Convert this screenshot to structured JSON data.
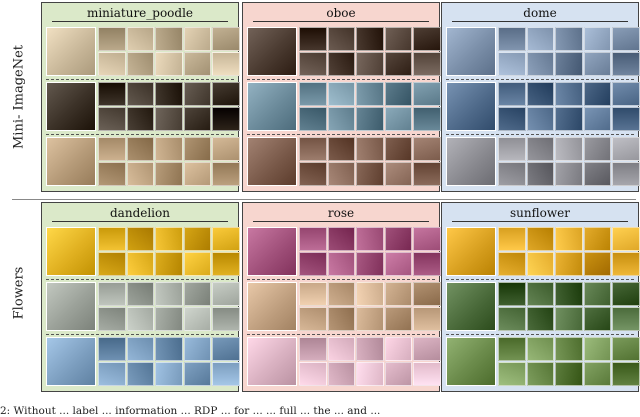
{
  "row_labels": [
    "Mini- ImageNet",
    "Flowers"
  ],
  "panels": [
    {
      "title": "miniature_poodle",
      "theme": "green",
      "colors": [
        "#c9b89a",
        "#3a3026",
        "#b59a78"
      ]
    },
    {
      "title": "oboe",
      "theme": "pink",
      "colors": [
        "#4a3a30",
        "#6b8a9a",
        "#7a5a4a"
      ]
    },
    {
      "title": "dome",
      "theme": "blue",
      "colors": [
        "#7a8ea8",
        "#4f6a8a",
        "#8a8a90"
      ]
    },
    {
      "title": "dandelion",
      "theme": "green",
      "colors": [
        "#e0b020",
        "#9aa098",
        "#7d9fc0"
      ]
    },
    {
      "title": "rose",
      "theme": "pink",
      "colors": [
        "#a0507a",
        "#c0a080",
        "#d8b0c0"
      ]
    },
    {
      "title": "sunflower",
      "theme": "blue",
      "colors": [
        "#d8a020",
        "#4a6a3a",
        "#6a8a4a"
      ]
    }
  ],
  "caption": "2: Without ... label ... information ... RDP ... for ... ... full ... the ... and ... "
}
